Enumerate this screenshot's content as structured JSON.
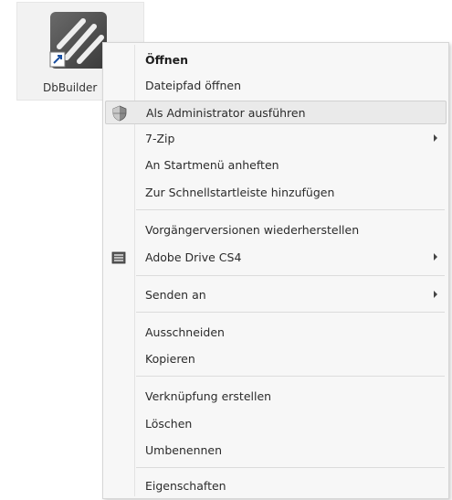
{
  "desktop_icon": {
    "label": "DbBuilder",
    "icon": "shortcut-app-icon"
  },
  "context_menu": {
    "items": [
      {
        "label": "Öffnen",
        "bold": true
      },
      {
        "label": "Dateipfad öffnen"
      },
      {
        "label": "Als Administrator ausführen",
        "icon": "uac-shield-icon",
        "highlighted": true
      },
      {
        "label": "7-Zip",
        "submenu": true
      },
      {
        "label": "An Startmenü anheften"
      },
      {
        "label": "Zur Schnellstartleiste hinzufügen"
      },
      {
        "label": "Vorgängerversionen wiederherstellen"
      },
      {
        "label": "Adobe Drive CS4",
        "icon": "adobe-drive-icon",
        "submenu": true
      },
      {
        "label": "Senden an",
        "submenu": true
      },
      {
        "label": "Ausschneiden"
      },
      {
        "label": "Kopieren"
      },
      {
        "label": "Verknüpfung erstellen"
      },
      {
        "label": "Löschen"
      },
      {
        "label": "Umbenennen"
      },
      {
        "label": "Eigenschaften"
      }
    ]
  }
}
